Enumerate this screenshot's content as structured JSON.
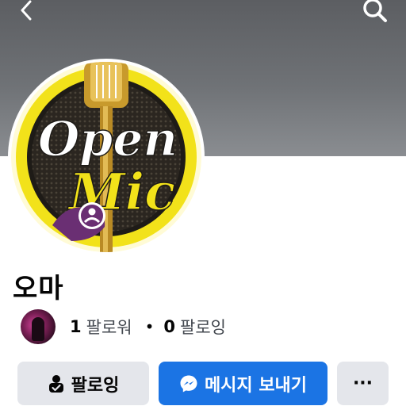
{
  "nav": {
    "back_icon": "chevron-left-icon",
    "search_icon": "search-icon"
  },
  "profile": {
    "name": "오마",
    "avatar_logo_top": "Open",
    "avatar_logo_bottom": "Mic"
  },
  "stats": {
    "followers_count": "1",
    "followers_label": "팔로워",
    "separator": "•",
    "following_count": "0",
    "following_label": "팔로잉"
  },
  "actions": {
    "following_label": "팔로잉",
    "following_icon": "person-check-icon",
    "message_label": "메시지 보내기",
    "message_icon": "messenger-icon",
    "more_label": "···"
  },
  "colors": {
    "primary": "#1b74e4",
    "secondary_button": "#e4e6eb",
    "logo_yellow": "#f2e21a",
    "logo_dark": "#2b2620",
    "badge_purple": "#6a2f73"
  }
}
